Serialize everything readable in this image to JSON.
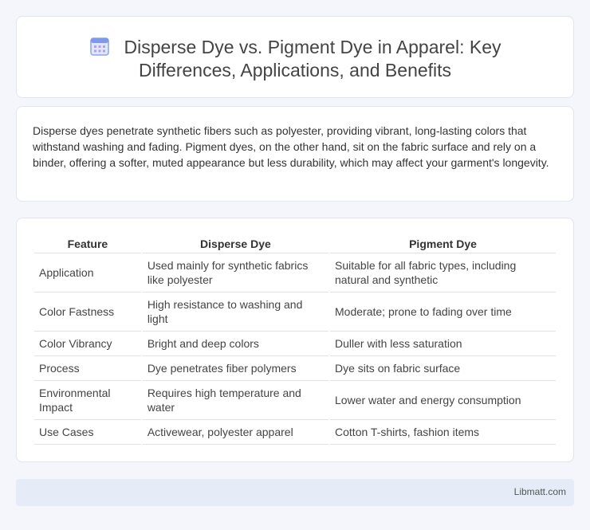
{
  "header": {
    "title_line1": "Disperse Dye vs. Pigment Dye in Apparel: Key",
    "title_line2": "Differences, Applications, and Benefits",
    "icon": "calendar-icon"
  },
  "intro": {
    "text": "Disperse dyes penetrate synthetic fibers such as polyester, providing vibrant, long-lasting colors that withstand washing and fading. Pigment dyes, on the other hand, sit on the fabric surface and rely on a binder, offering a softer, muted appearance but less durability, which may affect your garment's longevity."
  },
  "table": {
    "headers": [
      "Feature",
      "Disperse Dye",
      "Pigment Dye"
    ],
    "rows": [
      [
        "Application",
        "Used mainly for synthetic fabrics like polyester",
        "Suitable for all fabric types, including natural and synthetic"
      ],
      [
        "Color Fastness",
        "High resistance to washing and light",
        "Moderate; prone to fading over time"
      ],
      [
        "Color Vibrancy",
        "Bright and deep colors",
        "Duller with less saturation"
      ],
      [
        "Process",
        "Dye penetrates fiber polymers",
        "Dye sits on fabric surface"
      ],
      [
        "Environmental Impact",
        "Requires high temperature and water",
        "Lower water and energy consumption"
      ],
      [
        "Use Cases",
        "Activewear, polyester apparel",
        "Cotton T-shirts, fashion items"
      ]
    ]
  },
  "footer": {
    "brand": "Libmatt.com"
  },
  "colors": {
    "background": "#f4f6fb",
    "footer_bg": "#e6ecf7",
    "icon_accent": "#6f8fe8",
    "icon_grid": "#b89be8"
  }
}
